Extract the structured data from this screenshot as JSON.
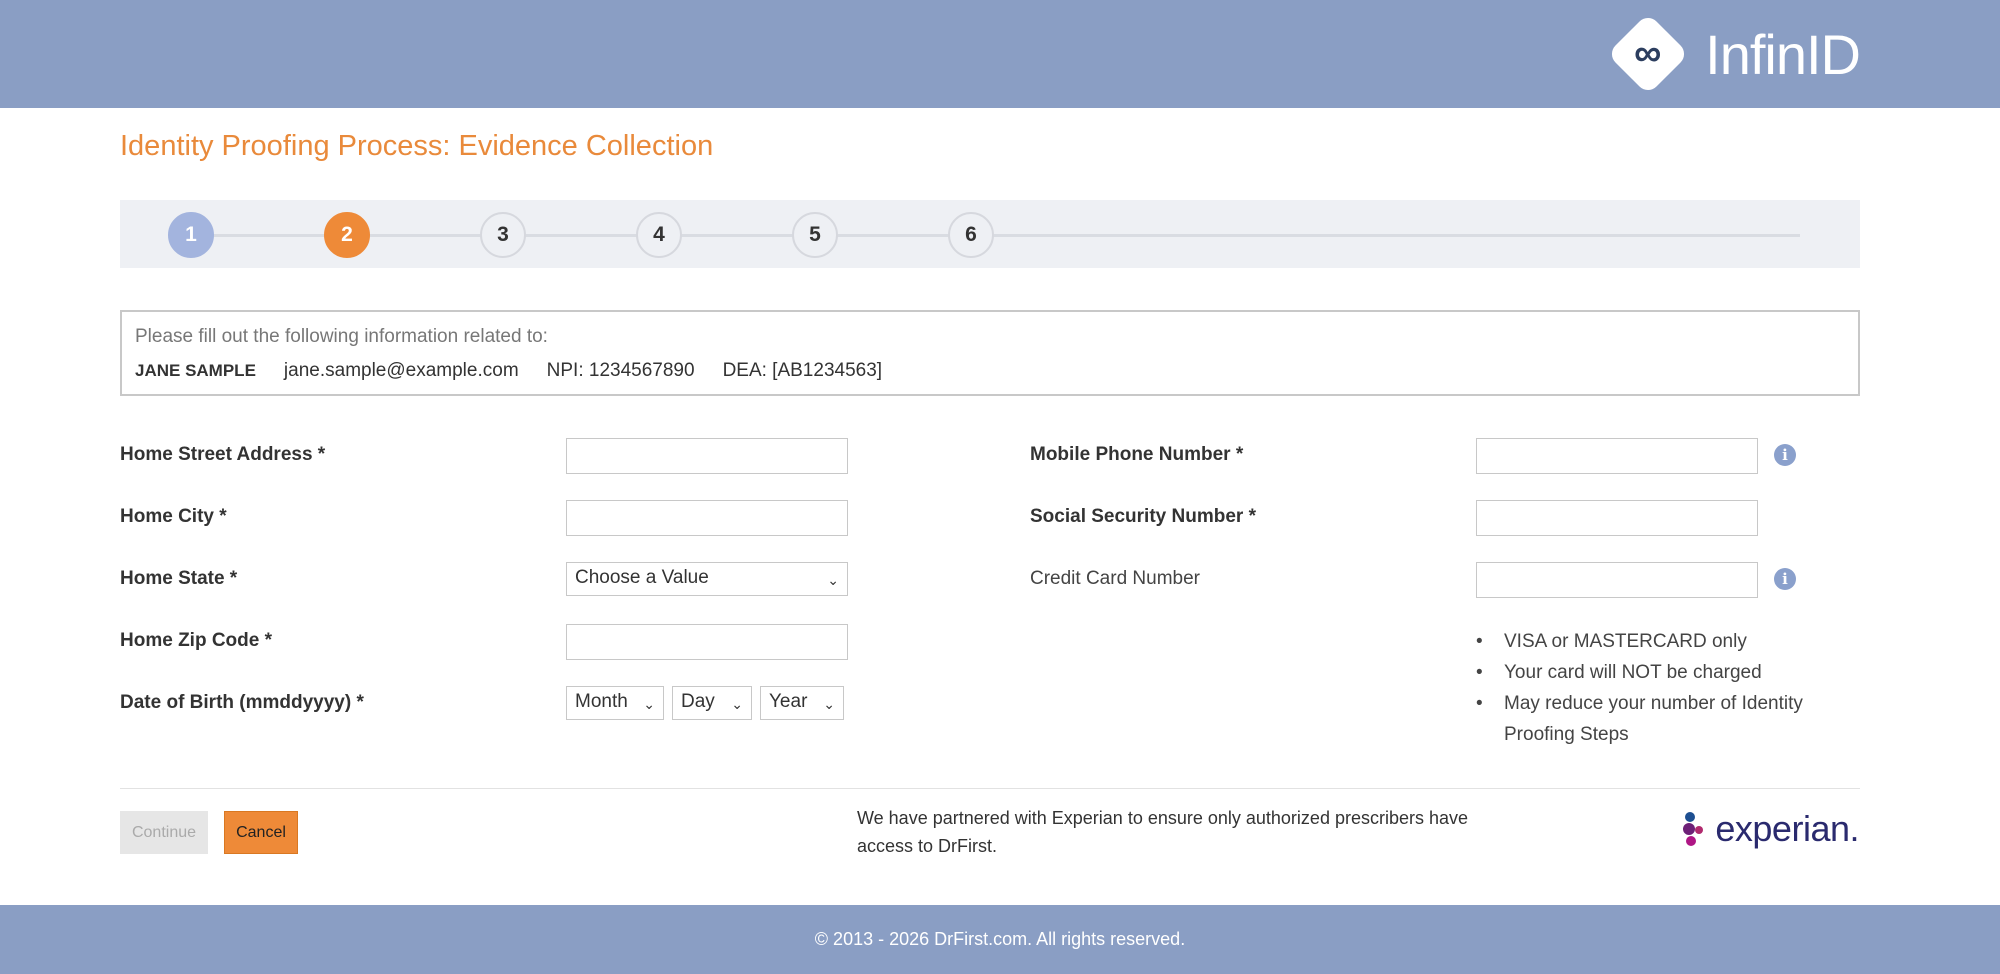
{
  "header": {
    "brand": "InfinID",
    "logo_icon": "infinity-icon",
    "logo_glyph": "∞"
  },
  "page": {
    "title": "Identity Proofing Process: Evidence Collection"
  },
  "stepper": {
    "steps": [
      "1",
      "2",
      "3",
      "4",
      "5",
      "6"
    ],
    "current_step": 2
  },
  "info": {
    "intro": "Please fill out the following information related to:",
    "name": "JANE SAMPLE",
    "email": "jane.sample@example.com",
    "npi": "NPI: 1234567890",
    "dea": "DEA: [AB1234563]"
  },
  "form": {
    "street_label": "Home Street Address *",
    "city_label": "Home City *",
    "state_label": "Home State *",
    "state_value": "Choose a Value",
    "zip_label": "Home Zip Code *",
    "dob_label": "Date of Birth (mmddyyyy) *",
    "dob_month": "Month",
    "dob_day": "Day",
    "dob_year": "Year",
    "phone_label": "Mobile Phone Number *",
    "ssn_label": "Social Security Number *",
    "cc_label": "Credit Card Number",
    "cc_notes": [
      "VISA or MASTERCARD only",
      "Your card will NOT be charged",
      "May reduce your number of Identity Proofing Steps"
    ]
  },
  "actions": {
    "continue_label": "Continue",
    "cancel_label": "Cancel"
  },
  "partner": {
    "text": "We have partnered with Experian to ensure only authorized prescribers have access to DrFirst.",
    "logo_text": "experian."
  },
  "footer": {
    "copyright": "© 2013 - 2026 DrFirst.com. All rights reserved."
  },
  "colors": {
    "header_bg": "#8a9ec4",
    "accent": "#ee8a38",
    "step_done": "#a3b4de",
    "title": "#e98a3b"
  }
}
